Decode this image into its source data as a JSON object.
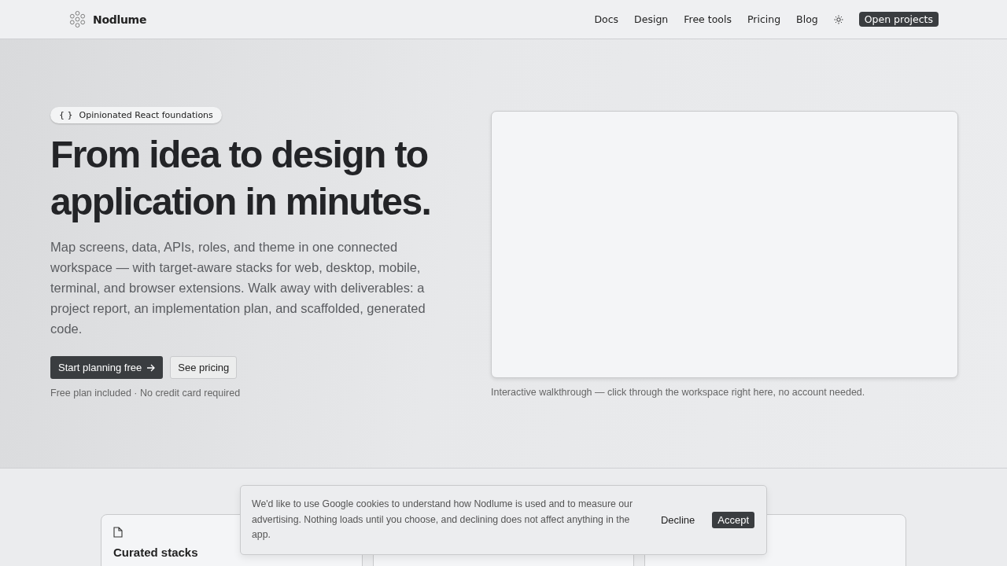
{
  "nav": {
    "brand": "Nodlume",
    "links": [
      "Docs",
      "Design",
      "Free tools",
      "Pricing",
      "Blog"
    ],
    "cta": "Open projects"
  },
  "hero": {
    "badge_icon": "{ }",
    "badge": "Opinionated React foundations",
    "title": "From idea to design to application in minutes.",
    "lead": "Map screens, data, APIs, roles, and theme in one connected workspace — with target-aware stacks for web, desktop, mobile, terminal, and browser extensions. Walk away with deliverables: a project report, an implementation plan, and scaffolded, generated code.",
    "primary": "Start planning free",
    "secondary": "See pricing",
    "note": "Free plan included · No credit card required",
    "demo_caption": "Interactive walkthrough — click through the workspace right here, no account needed."
  },
  "features": [
    {
      "kind": "titled",
      "title": "Curated stacks"
    },
    {
      "kind": "covered"
    },
    {
      "kind": "covered"
    }
  ],
  "cookie_banner": {
    "text": "We'd like to use Google cookies to understand how Nodlume is used and to measure our advertising. Nothing loads until you choose, and declining does not affect anything in the app.",
    "decline": "Decline",
    "accept": "Accept"
  }
}
